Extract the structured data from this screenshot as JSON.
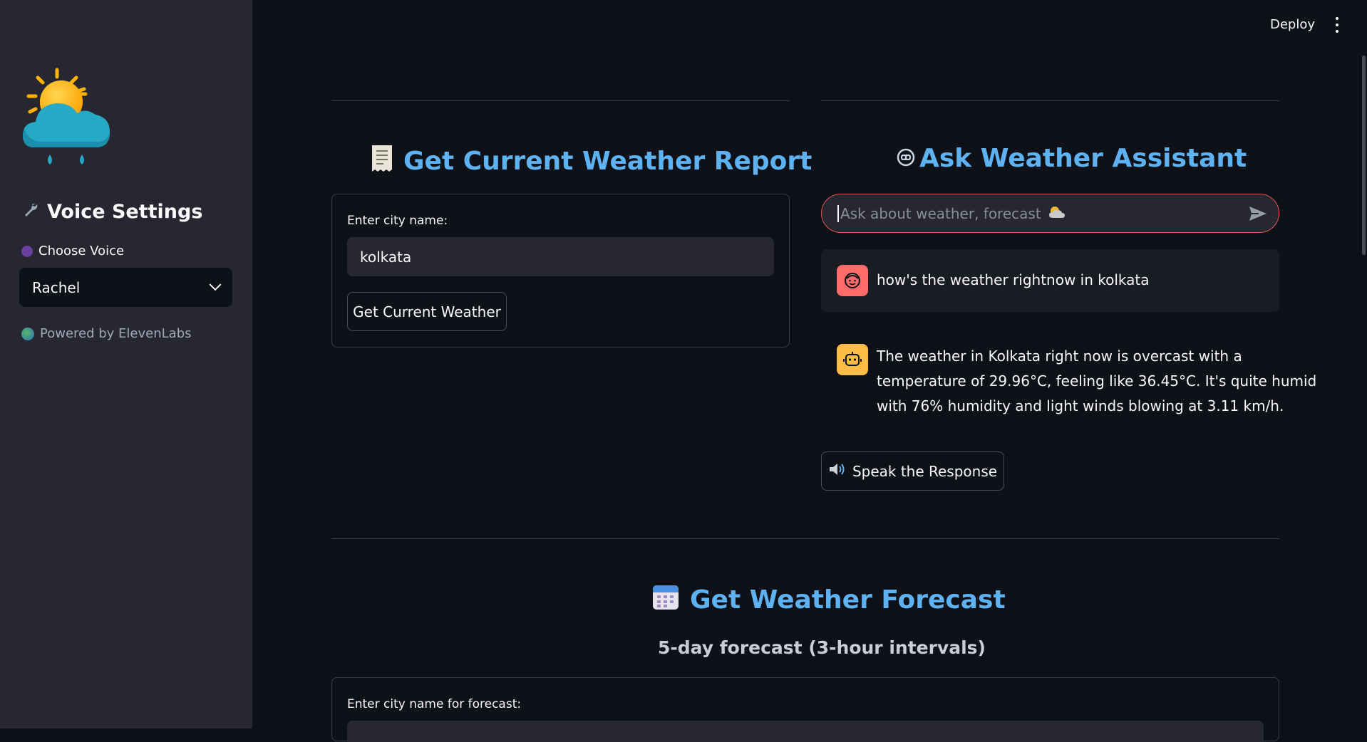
{
  "topbar": {
    "deploy_label": "Deploy"
  },
  "sidebar": {
    "title": "Voice Settings",
    "choose_voice_label": "Choose Voice",
    "voice_selected": "Rachel",
    "powered_by": "Powered by ElevenLabs"
  },
  "current_weather": {
    "heading": "Get Current Weather Report",
    "city_label": "Enter city name:",
    "city_value": "kolkata",
    "button_label": "Get Current Weather"
  },
  "assistant": {
    "heading": "Ask Weather Assistant",
    "input_placeholder": "Ask about weather, forecast",
    "user_message": "how's the weather rightnow in kolkata",
    "bot_message_lines": [
      "The weather in Kolkata right now is overcast with a",
      "temperature of 29.96°C, feeling like 36.45°C. It's quite humid",
      "with 76% humidity and light winds blowing at 3.11 km/h."
    ],
    "speak_button_label": "Speak the Response"
  },
  "forecast": {
    "heading": "Get Weather Forecast",
    "subheading": "5-day forecast (3-hour intervals)",
    "city_label": "Enter city name for forecast:"
  },
  "icons": {
    "logo": "weather-sun-cloud-rain-icon",
    "wrench": "wrench-icon",
    "receipt": "receipt-icon",
    "robot": "robot-face-icon",
    "send": "send-icon",
    "speaker": "speaker-icon",
    "calendar": "calendar-icon"
  },
  "colors": {
    "heading_blue": "#5eb2f2",
    "input_border_red": "#e05555",
    "user_avatar": "#ff6b6b",
    "bot_avatar": "#ffbd45"
  }
}
